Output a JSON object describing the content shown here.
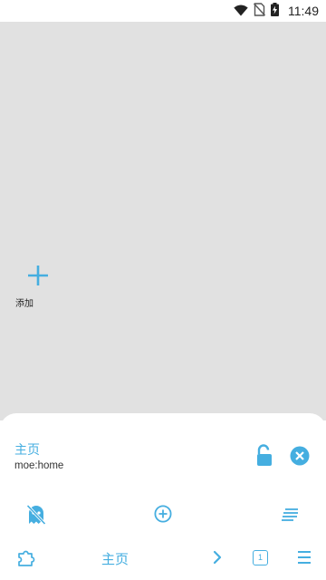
{
  "status_bar": {
    "time": "11:49",
    "icons": [
      "wifi-icon",
      "no-sim-icon",
      "battery-charging-icon"
    ]
  },
  "home": {
    "add_tile": {
      "icon": "plus-icon",
      "label": "添加"
    }
  },
  "sheet": {
    "title": "主页",
    "url": "moe:home",
    "lock_icon": "lock-open-icon",
    "close_icon": "close-circle-icon"
  },
  "actions": [
    {
      "name": "ghost-off-icon"
    },
    {
      "name": "add-circle-icon"
    },
    {
      "name": "reader-mode-icon"
    }
  ],
  "nav": {
    "extensions_icon": "puzzle-icon",
    "title": "主页",
    "forward_icon": "chevron-right-icon",
    "tab_count": "1",
    "menu_icon": "menu-icon"
  },
  "colors": {
    "accent": "#45aee0",
    "home_background": "#e1e1e1"
  }
}
